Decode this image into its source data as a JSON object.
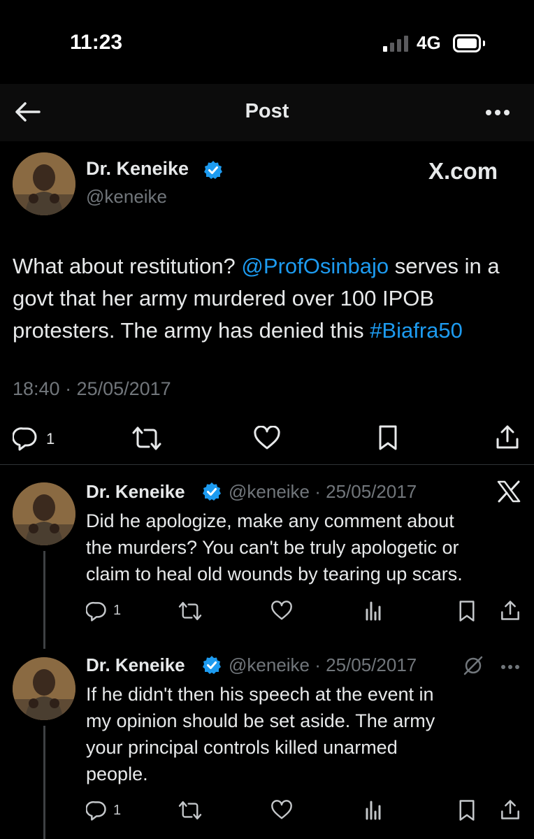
{
  "status_bar": {
    "time": "11:23",
    "network": "4G"
  },
  "header": {
    "title": "Post"
  },
  "main_post": {
    "author_name": "Dr. Keneike",
    "handle": "@keneike",
    "source": "X.com",
    "text_part1": "What about restitution? ",
    "mention": "@ProfOsinbajo",
    "text_part2": " serves in a govt that her army murdered over 100 IPOB protesters. The army has denied this ",
    "hashtag": "#Biafra50",
    "timestamp": "18:40 · 25/05/2017",
    "reply_count": "1"
  },
  "replies": [
    {
      "author_name": "Dr. Keneike",
      "handle_date": "@keneike · 25/05/2017",
      "text_lines": [
        "Did he apologize, make any comment about",
        "the murders? You can't be truly apologetic or",
        "claim to heal old wounds by tearing up scars."
      ],
      "reply_count": "1"
    },
    {
      "author_name": "Dr. Keneike",
      "handle_date": "@keneike · 25/05/2017",
      "text_lines": [
        "If he didn't then his speech at the event in",
        "my opinion should be set aside. The army",
        "your principal controls killed unarmed",
        "people."
      ],
      "reply_count": "1"
    }
  ],
  "colors": {
    "accent": "#1d9bf0",
    "muted": "#71767b",
    "background": "#000000",
    "text": "#e7e9ea"
  },
  "icons": [
    "back-arrow-icon",
    "more-horizontal-icon",
    "verified-badge-icon",
    "x-logo-icon",
    "reply-icon",
    "retweet-icon",
    "like-icon",
    "bookmark-icon",
    "share-icon",
    "views-icon",
    "grok-icon"
  ]
}
